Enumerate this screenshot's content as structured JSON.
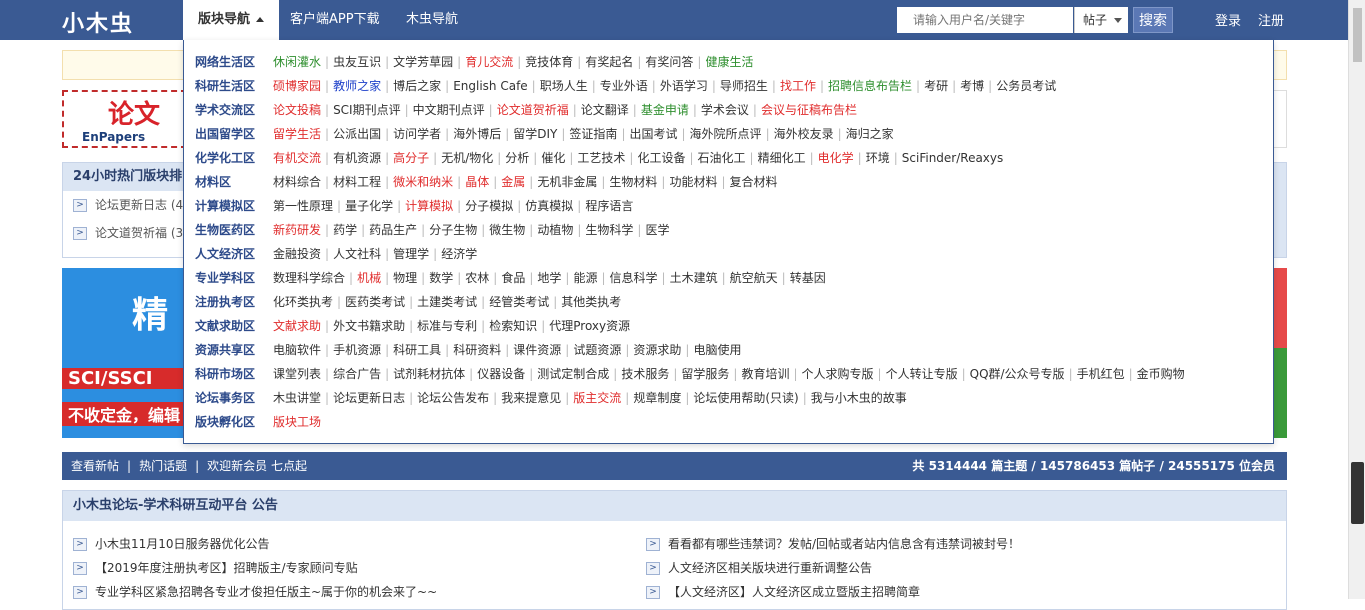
{
  "header": {
    "logo": "小木虫",
    "nav": [
      {
        "label": "版块导航",
        "active": true
      },
      {
        "label": "客户端APP下载"
      },
      {
        "label": "木虫导航"
      }
    ],
    "search": {
      "placeholder": "请输入用户名/关键字",
      "type": "帖子",
      "button": "搜索"
    },
    "login": "登录",
    "register": "注册"
  },
  "background": {
    "banner1_big": "论文",
    "banner1_small": "EnPapers",
    "hot_title": "24小时热门版块排",
    "hot_rows": [
      "论坛更新日志 (4",
      "论文道贺祈福 (3"
    ],
    "banner2_t0": "精",
    "banner2_t1": "SCI/SSCI",
    "banner2_t2": "不收定金，编辑"
  },
  "stats": {
    "links": [
      "查看新帖",
      "热门话题",
      "欢迎新会员 七点起"
    ],
    "summary": "共 5314444 篇主题  /  145786453 篇帖子  /  24555175 位会员"
  },
  "announcement": {
    "title": "小木虫论坛-学术科研互动平台 公告",
    "left": [
      "小木虫11月10日服务器优化公告",
      "【2019年度注册执考区】招聘版主/专家顾问专贴",
      "专业学科区紧急招聘各专业才俊担任版主~属于你的机会来了~~"
    ],
    "right": [
      "看看都有哪些违禁词？发帖/回帖或者站内信息含有违禁词被封号！",
      "人文经济区相关版块进行重新调整公告",
      "【人文经济区】人文经济区成立暨版主招聘简章"
    ]
  },
  "colors": {
    "brand": "#3a5a93",
    "red": "#e02d2d",
    "green": "#2f8f2f",
    "blue": "#1e40c9"
  },
  "categories": [
    {
      "title": "网络生活区",
      "links": [
        {
          "t": "休闲灌水",
          "c": "green"
        },
        {
          "t": "虫友互识"
        },
        {
          "t": "文学芳草园"
        },
        {
          "t": "育儿交流",
          "c": "red"
        },
        {
          "t": "竞技体育"
        },
        {
          "t": "有奖起名"
        },
        {
          "t": "有奖问答"
        },
        {
          "t": "健康生活",
          "c": "green"
        }
      ]
    },
    {
      "title": "科研生活区",
      "links": [
        {
          "t": "硕博家园",
          "c": "red"
        },
        {
          "t": "教师之家",
          "c": "blue"
        },
        {
          "t": "博后之家"
        },
        {
          "t": "English Cafe"
        },
        {
          "t": "职场人生"
        },
        {
          "t": "专业外语"
        },
        {
          "t": "外语学习"
        },
        {
          "t": "导师招生"
        },
        {
          "t": "找工作",
          "c": "red"
        },
        {
          "t": "招聘信息布告栏",
          "c": "green"
        },
        {
          "t": "考研"
        },
        {
          "t": "考博"
        },
        {
          "t": "公务员考试"
        }
      ]
    },
    {
      "title": "学术交流区",
      "links": [
        {
          "t": "论文投稿",
          "c": "red"
        },
        {
          "t": "SCI期刊点评"
        },
        {
          "t": "中文期刊点评"
        },
        {
          "t": "论文道贺祈福",
          "c": "red"
        },
        {
          "t": "论文翻译"
        },
        {
          "t": "基金申请",
          "c": "green"
        },
        {
          "t": "学术会议"
        },
        {
          "t": "会议与征稿布告栏",
          "c": "red"
        }
      ]
    },
    {
      "title": "出国留学区",
      "links": [
        {
          "t": "留学生活",
          "c": "red"
        },
        {
          "t": "公派出国"
        },
        {
          "t": "访问学者"
        },
        {
          "t": "海外博后"
        },
        {
          "t": "留学DIY"
        },
        {
          "t": "签证指南"
        },
        {
          "t": "出国考试"
        },
        {
          "t": "海外院所点评"
        },
        {
          "t": "海外校友录"
        },
        {
          "t": "海归之家"
        }
      ]
    },
    {
      "title": "化学化工区",
      "links": [
        {
          "t": "有机交流",
          "c": "red"
        },
        {
          "t": "有机资源"
        },
        {
          "t": "高分子",
          "c": "red"
        },
        {
          "t": "无机/物化"
        },
        {
          "t": "分析"
        },
        {
          "t": "催化"
        },
        {
          "t": "工艺技术"
        },
        {
          "t": "化工设备"
        },
        {
          "t": "石油化工"
        },
        {
          "t": "精细化工"
        },
        {
          "t": "电化学",
          "c": "red"
        },
        {
          "t": "环境"
        },
        {
          "t": "SciFinder/Reaxys"
        }
      ]
    },
    {
      "title": "材料区",
      "links": [
        {
          "t": "材料综合"
        },
        {
          "t": "材料工程"
        },
        {
          "t": "微米和纳米",
          "c": "red"
        },
        {
          "t": "晶体",
          "c": "red"
        },
        {
          "t": "金属",
          "c": "red"
        },
        {
          "t": "无机非金属"
        },
        {
          "t": "生物材料"
        },
        {
          "t": "功能材料"
        },
        {
          "t": "复合材料"
        }
      ]
    },
    {
      "title": "计算模拟区",
      "links": [
        {
          "t": "第一性原理"
        },
        {
          "t": "量子化学"
        },
        {
          "t": "计算模拟",
          "c": "red"
        },
        {
          "t": "分子模拟"
        },
        {
          "t": "仿真模拟"
        },
        {
          "t": "程序语言"
        }
      ]
    },
    {
      "title": "生物医药区",
      "links": [
        {
          "t": "新药研发",
          "c": "red"
        },
        {
          "t": "药学"
        },
        {
          "t": "药品生产"
        },
        {
          "t": "分子生物"
        },
        {
          "t": "微生物"
        },
        {
          "t": "动植物"
        },
        {
          "t": "生物科学"
        },
        {
          "t": "医学"
        }
      ]
    },
    {
      "title": "人文经济区",
      "links": [
        {
          "t": "金融投资"
        },
        {
          "t": "人文社科"
        },
        {
          "t": "管理学"
        },
        {
          "t": "经济学"
        }
      ]
    },
    {
      "title": "专业学科区",
      "links": [
        {
          "t": "数理科学综合"
        },
        {
          "t": "机械",
          "c": "red"
        },
        {
          "t": "物理"
        },
        {
          "t": "数学"
        },
        {
          "t": "农林"
        },
        {
          "t": "食品"
        },
        {
          "t": "地学"
        },
        {
          "t": "能源"
        },
        {
          "t": "信息科学"
        },
        {
          "t": "土木建筑"
        },
        {
          "t": "航空航天"
        },
        {
          "t": "转基因"
        }
      ]
    },
    {
      "title": "注册执考区",
      "links": [
        {
          "t": "化环类执考"
        },
        {
          "t": "医药类考试"
        },
        {
          "t": "土建类考试"
        },
        {
          "t": "经管类考试"
        },
        {
          "t": "其他类执考"
        }
      ]
    },
    {
      "title": "文献求助区",
      "links": [
        {
          "t": "文献求助",
          "c": "red"
        },
        {
          "t": "外文书籍求助"
        },
        {
          "t": "标准与专利"
        },
        {
          "t": "检索知识"
        },
        {
          "t": "代理Proxy资源"
        }
      ]
    },
    {
      "title": "资源共享区",
      "links": [
        {
          "t": "电脑软件"
        },
        {
          "t": "手机资源"
        },
        {
          "t": "科研工具"
        },
        {
          "t": "科研资料"
        },
        {
          "t": "课件资源"
        },
        {
          "t": "试题资源"
        },
        {
          "t": "资源求助"
        },
        {
          "t": "电脑使用"
        }
      ]
    },
    {
      "title": "科研市场区",
      "links": [
        {
          "t": "课堂列表"
        },
        {
          "t": "综合广告"
        },
        {
          "t": "试剂耗材抗体"
        },
        {
          "t": "仪器设备"
        },
        {
          "t": "测试定制合成"
        },
        {
          "t": "技术服务"
        },
        {
          "t": "留学服务"
        },
        {
          "t": "教育培训"
        },
        {
          "t": "个人求购专版"
        },
        {
          "t": "个人转让专版"
        },
        {
          "t": "QQ群/公众号专版"
        },
        {
          "t": "手机红包"
        },
        {
          "t": "金币购物"
        }
      ]
    },
    {
      "title": "论坛事务区",
      "links": [
        {
          "t": "木虫讲堂"
        },
        {
          "t": "论坛更新日志"
        },
        {
          "t": "论坛公告发布"
        },
        {
          "t": "我来提意见"
        },
        {
          "t": "版主交流",
          "c": "red"
        },
        {
          "t": "规章制度"
        },
        {
          "t": "论坛使用帮助(只读)"
        },
        {
          "t": "我与小木虫的故事"
        }
      ]
    },
    {
      "title": "版块孵化区",
      "links": [
        {
          "t": "版块工场",
          "c": "red"
        }
      ]
    }
  ]
}
